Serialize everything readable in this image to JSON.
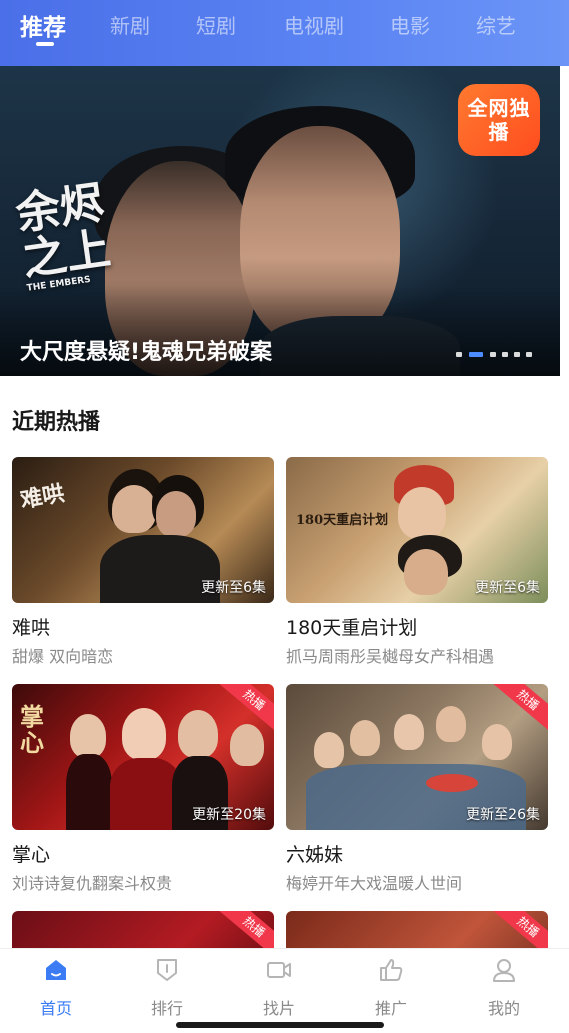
{
  "top_tabs": [
    {
      "label": "推荐",
      "active": true
    },
    {
      "label": "新剧",
      "active": false
    },
    {
      "label": "短剧",
      "active": false
    },
    {
      "label": "电视剧",
      "active": false
    },
    {
      "label": "电影",
      "active": false
    },
    {
      "label": "综艺",
      "active": false
    }
  ],
  "banner": {
    "title": "大尺度悬疑!鬼魂兄弟破案",
    "logo_text": "余烬之上",
    "logo_subtext": "THE EMBERS",
    "badge": "全网独播",
    "dots_count": 6,
    "active_dot": 0
  },
  "section": {
    "title": "近期热播"
  },
  "cards": [
    {
      "title": "难哄",
      "subtitle": "甜爆 双向暗恋",
      "update": "更新至6集",
      "hot": false,
      "poster_text": "难哄"
    },
    {
      "title": "180天重启计划",
      "subtitle": "抓马周雨彤吴樾母女产科相遇",
      "update": "更新至6集",
      "hot": false,
      "poster_text": "180天重启计划"
    },
    {
      "title": "掌心",
      "subtitle": "刘诗诗复仇翻案斗权贵",
      "update": "更新至20集",
      "hot": true,
      "hot_label": "热播",
      "poster_text": "掌心"
    },
    {
      "title": "六姊妹",
      "subtitle": "梅婷开年大戏温暖人世间",
      "update": "更新至26集",
      "hot": true,
      "hot_label": "热播"
    }
  ],
  "partial_cards": [
    {
      "hot_label": "热播"
    },
    {
      "hot_label": "热播"
    }
  ],
  "bottom_nav": [
    {
      "label": "首页",
      "icon": "home-icon",
      "active": true
    },
    {
      "label": "排行",
      "icon": "ranking-icon",
      "active": false
    },
    {
      "label": "找片",
      "icon": "video-search-icon",
      "active": false
    },
    {
      "label": "推广",
      "icon": "thumbs-up-icon",
      "active": false
    },
    {
      "label": "我的",
      "icon": "profile-icon",
      "active": false
    }
  ],
  "colors": {
    "accent": "#3b7cf5",
    "hot_tag": "#f0384a",
    "badge": "#ff5a23"
  }
}
